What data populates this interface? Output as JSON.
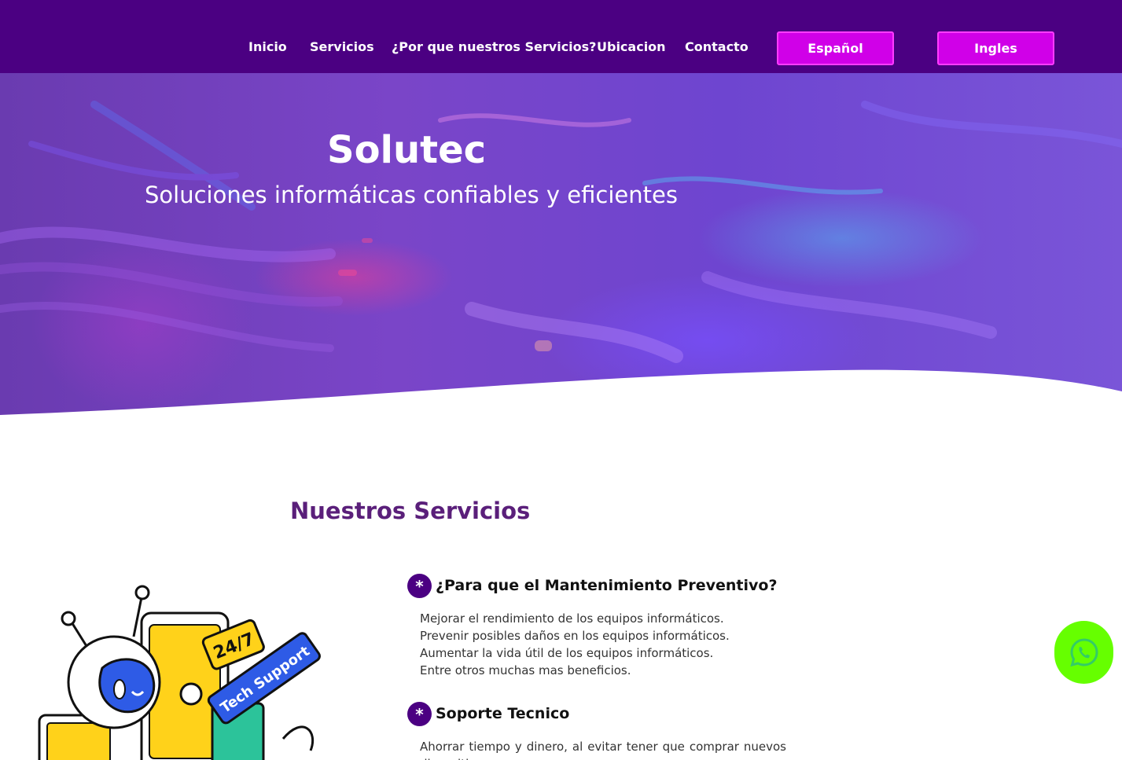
{
  "nav": {
    "links": [
      "Inicio",
      "Servicios",
      "¿Por que nuestros Servicios?",
      "Ubicacion",
      "Contacto"
    ],
    "lang_es": "Español",
    "lang_en": "Ingles"
  },
  "hero": {
    "title": "Solutec",
    "subtitle": "Soluciones informáticas confiables y eficientes"
  },
  "services": {
    "section_title": "Nuestros Servicios",
    "bullet": "*",
    "illustration_text": [
      "24/7",
      "Tech Support"
    ],
    "items": [
      {
        "title": "¿Para que el Mantenimiento Preventivo?",
        "lines": [
          "Mejorar el rendimiento de los equipos informáticos.",
          "Prevenir posibles daños en los equipos informáticos.",
          "Aumentar la vida útil de los equipos informáticos.",
          "Entre otros muchas mas beneficios."
        ]
      },
      {
        "title": "Soporte Tecnico",
        "text": "Ahorrar tiempo y dinero, al evitar tener que comprar nuevos dispositivos."
      }
    ]
  },
  "colors": {
    "navbar": "#4b0082",
    "lang_button": "#d000e8",
    "section_title": "#5a1f7a",
    "whatsapp": "#66ff00"
  },
  "icons": {
    "whatsapp": "whatsapp-icon"
  }
}
